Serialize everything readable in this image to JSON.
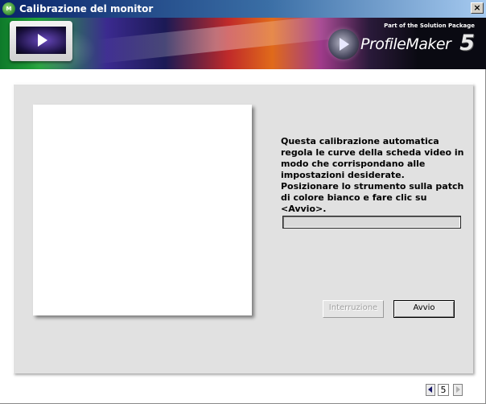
{
  "window": {
    "title": "Calibrazione del monitor",
    "app_icon_text": "M"
  },
  "banner": {
    "tagline": "Part of the Solution Package",
    "product_name": "ProfileMaker",
    "product_version": "5"
  },
  "main": {
    "instructions": "Questa calibrazione automatica regola le curve della scheda video in modo che corrispondano alle impostazioni desiderate. Posizionare lo strumento sulla patch di colore bianco e fare clic su <Avvio>.",
    "progress": 0,
    "stop_button": "Interruzione",
    "start_button": "Avvio"
  },
  "pager": {
    "current_page": "5"
  },
  "colors": {
    "title_bar_start": "#0a246a",
    "panel_background": "#e1e1e1",
    "progress_fill": "#316ac5"
  },
  "icons": {
    "app": "green-app-icon",
    "close": "close-icon",
    "monitor": "monitor-icon",
    "brand": "profilemaker-logo",
    "prev": "previous-arrow-icon",
    "next": "next-arrow-icon"
  }
}
